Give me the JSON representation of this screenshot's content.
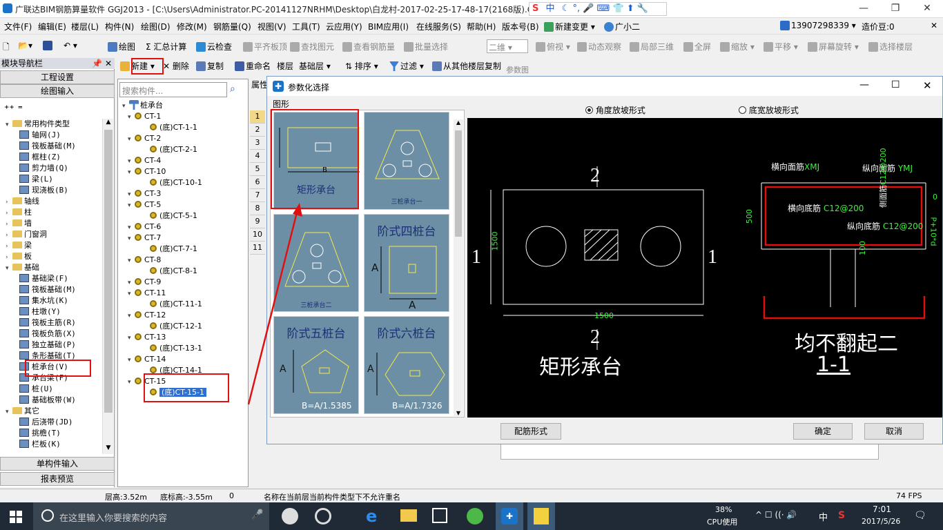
{
  "window": {
    "title": "广联达BIM钢筋算量软件 GGJ2013 - [C:\\Users\\Administrator.PC-20141127NRHM\\Desktop\\白龙村-2017-02-25-17-48-17(2168版).G"
  },
  "menu": [
    "文件(F)",
    "编辑(E)",
    "楼层(L)",
    "构件(N)",
    "绘图(D)",
    "修改(M)",
    "钢筋量(Q)",
    "视图(V)",
    "工具(T)",
    "云应用(Y)",
    "BIM应用(I)",
    "在线服务(S)",
    "帮助(H)",
    "版本号(B)",
    "新建变更",
    "广小二"
  ],
  "menu_right": {
    "phone": "13907298339",
    "price_label": "造价豆:0"
  },
  "toolbar1": [
    "绘图",
    "Σ 汇总计算",
    "云检查",
    "平齐板顶",
    "查找图元",
    "查看钢筋量",
    "批量选择",
    "二维",
    "俯视",
    "动态观察",
    "局部三维",
    "全屏",
    "缩放",
    "平移",
    "屏幕旋转",
    "选择楼层"
  ],
  "toolbar2": [
    "新建",
    "删除",
    "复制",
    "重命名",
    "楼层",
    "基础层",
    "排序",
    "过滤",
    "从其他楼层复制"
  ],
  "left_panel": {
    "title": "模块导航栏",
    "top_buttons": [
      "工程设置",
      "绘图输入"
    ],
    "tree": [
      {
        "label": "常用构件类型",
        "type": "folder",
        "level": 0,
        "open": true
      },
      {
        "label": "轴网(J)",
        "level": 1
      },
      {
        "label": "筏板基础(M)",
        "level": 1
      },
      {
        "label": "框柱(Z)",
        "level": 1
      },
      {
        "label": "剪力墙(Q)",
        "level": 1
      },
      {
        "label": "梁(L)",
        "level": 1
      },
      {
        "label": "现浇板(B)",
        "level": 1
      },
      {
        "label": "轴线",
        "type": "folder",
        "level": 0
      },
      {
        "label": "柱",
        "type": "folder",
        "level": 0
      },
      {
        "label": "墙",
        "type": "folder",
        "level": 0
      },
      {
        "label": "门窗洞",
        "type": "folder",
        "level": 0
      },
      {
        "label": "梁",
        "type": "folder",
        "level": 0
      },
      {
        "label": "板",
        "type": "folder",
        "level": 0
      },
      {
        "label": "基础",
        "type": "folder",
        "level": 0,
        "open": true
      },
      {
        "label": "基础梁(F)",
        "level": 1
      },
      {
        "label": "筏板基础(M)",
        "level": 1
      },
      {
        "label": "集水坑(K)",
        "level": 1
      },
      {
        "label": "柱墩(Y)",
        "level": 1
      },
      {
        "label": "筏板主筋(R)",
        "level": 1
      },
      {
        "label": "筏板负筋(X)",
        "level": 1
      },
      {
        "label": "独立基础(P)",
        "level": 1
      },
      {
        "label": "条形基础(T)",
        "level": 1
      },
      {
        "label": "桩承台(V)",
        "level": 1,
        "selected": true
      },
      {
        "label": "承台梁(F)",
        "level": 1
      },
      {
        "label": "桩(U)",
        "level": 1
      },
      {
        "label": "基础板带(W)",
        "level": 1
      },
      {
        "label": "其它",
        "type": "folder",
        "level": 0,
        "open": true
      },
      {
        "label": "后浇带(JD)",
        "level": 1
      },
      {
        "label": "挑檐(T)",
        "level": 1
      },
      {
        "label": "栏板(K)",
        "level": 1
      }
    ],
    "bottom_buttons": [
      "单构件输入",
      "报表预览"
    ]
  },
  "mid_panel": {
    "search_placeholder": "搜索构件...",
    "root": "桩承台",
    "items": [
      {
        "label": "CT-1",
        "level": 0
      },
      {
        "label": "(底)CT-1-1",
        "level": 1
      },
      {
        "label": "CT-2",
        "level": 0
      },
      {
        "label": "(底)CT-2-1",
        "level": 1
      },
      {
        "label": "CT-4",
        "level": 0
      },
      {
        "label": "CT-10",
        "level": 0
      },
      {
        "label": "(底)CT-10-1",
        "level": 1
      },
      {
        "label": "CT-3",
        "level": 0
      },
      {
        "label": "CT-5",
        "level": 0
      },
      {
        "label": "(底)CT-5-1",
        "level": 1
      },
      {
        "label": "CT-6",
        "level": 0
      },
      {
        "label": "CT-7",
        "level": 0
      },
      {
        "label": "(底)CT-7-1",
        "level": 1
      },
      {
        "label": "CT-8",
        "level": 0
      },
      {
        "label": "(底)CT-8-1",
        "level": 1
      },
      {
        "label": "CT-9",
        "level": 0
      },
      {
        "label": "CT-11",
        "level": 0
      },
      {
        "label": "(底)CT-11-1",
        "level": 1
      },
      {
        "label": "CT-12",
        "level": 0
      },
      {
        "label": "(底)CT-12-1",
        "level": 1
      },
      {
        "label": "CT-13",
        "level": 0
      },
      {
        "label": "(底)CT-13-1",
        "level": 1
      },
      {
        "label": "CT-14",
        "level": 0
      },
      {
        "label": "(底)CT-14-1",
        "level": 1
      },
      {
        "label": "CT-15",
        "level": 0
      },
      {
        "label": "(底)CT-15-1",
        "level": 1,
        "selected": true
      }
    ]
  },
  "prop_header": "属性",
  "row_numbers": [
    "1",
    "2",
    "3",
    "4",
    "5",
    "6",
    "7",
    "8",
    "9",
    "10",
    "11"
  ],
  "bg_panel_title": "参数图",
  "dialog": {
    "title": "参数化选择",
    "shapes_label": "图形",
    "radio1": "角度放坡形式",
    "radio2": "底宽放坡形式",
    "thumbnails": [
      "矩形承台",
      "三桩承台一",
      "三桩承台二",
      "阶式四桩台",
      "阶式五桩台",
      "阶式六桩台"
    ],
    "thumb_subs": {
      "t1": "B",
      "t4a": "A",
      "t4b": "A",
      "t5": "B=A/1.5385",
      "t6": "B=A/1.7326",
      "t5a": "A",
      "t6a": "A"
    },
    "buttons": {
      "rebar": "配筋形式",
      "ok": "确定",
      "cancel": "取消"
    },
    "cad": {
      "sec2_top": "2",
      "sec2_bottom": "2",
      "sec1_left": "1",
      "sec1_right": "1",
      "dim_left": "1500",
      "dim_bottom": "1500",
      "plan_title": "矩形承台",
      "h_top_bar": "横向面筋",
      "h_top_code": "XMJ",
      "v_top_bar": "纵向面筋",
      "v_top_code": "YMJ",
      "h_bot_bar": "横向底筋",
      "h_bot_code": "C12@200",
      "v_bot_bar": "纵向底筋",
      "v_bot_code": "C12@200",
      "side_bar": "侧面筋",
      "side_code": "C12@200",
      "dim_500": "500",
      "dim_100": "100",
      "dim_0": "0",
      "dim_pn": "P+10*d",
      "section_note": "均不翻起二",
      "section_title": "1-1"
    }
  },
  "status": {
    "floor_h": "层高:3.52m",
    "bottom_h": "底标高:-3.55m",
    "zero": "0",
    "message": "名称在当前层当前构件类型下不允许重名",
    "fps": "74 FPS"
  },
  "taskbar": {
    "search": "在这里输入你要搜索的内容",
    "cpu": "38%",
    "cpu_label": "CPU使用",
    "ime": "中",
    "time": "7:01",
    "date": "2017/5/26"
  }
}
